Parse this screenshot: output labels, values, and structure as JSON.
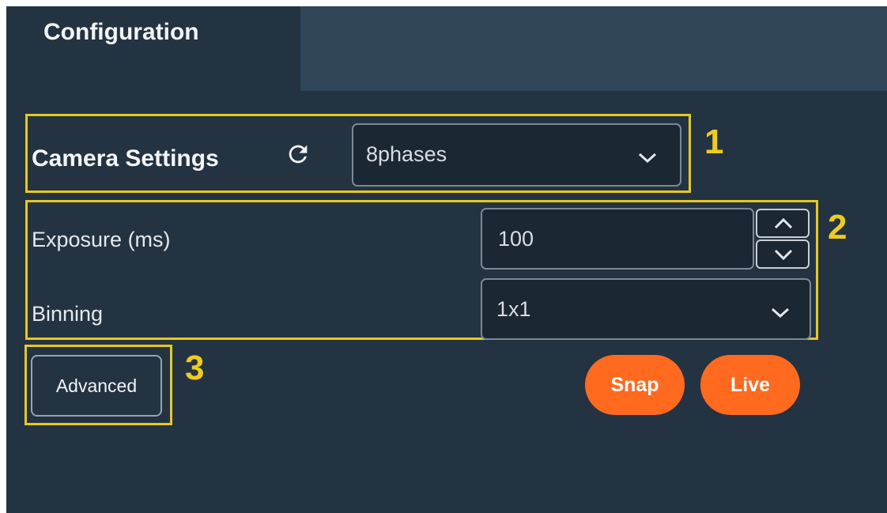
{
  "tabs": [
    {
      "label": "Configuration",
      "active": true
    }
  ],
  "camera_settings": {
    "title": "Camera Settings",
    "refresh_icon": "refresh-icon",
    "preset": {
      "value": "8phases",
      "icon": "chevron-down-icon"
    }
  },
  "fields": {
    "exposure": {
      "label": "Exposure (ms)",
      "value": "100"
    },
    "binning": {
      "label": "Binning",
      "value": "1x1"
    }
  },
  "buttons": {
    "advanced": "Advanced",
    "snap": "Snap",
    "live": "Live"
  },
  "annotations": {
    "one": "1",
    "two": "2",
    "three": "3"
  },
  "colors": {
    "panel_bg": "#243342",
    "tab_strip": "#314559",
    "accent": "#ff6a1f",
    "annotation": "#e8c81c"
  }
}
